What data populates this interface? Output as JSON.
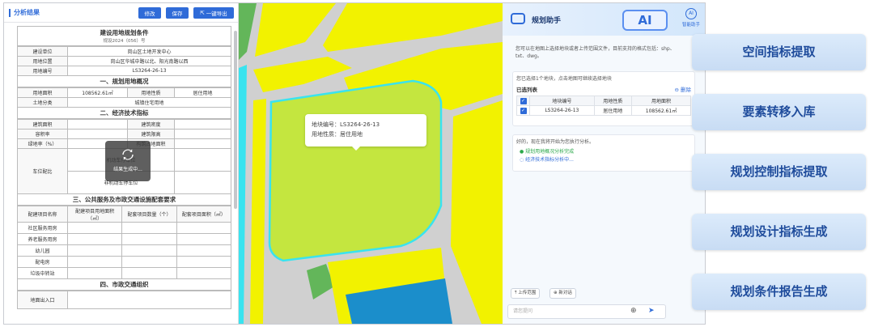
{
  "left_panel": {
    "title": "分析结果",
    "buttons": {
      "edit": "修改",
      "save": "保存",
      "export": "一键导出"
    },
    "doc": {
      "title": "建设用地规划条件",
      "subtitle": "规设2024（056）号",
      "rows": [
        {
          "label": "建设单位",
          "value": "岗山区土地开发中心"
        },
        {
          "label": "用地位置",
          "value": "岗山区华城中路以北、阳光南路以西"
        },
        {
          "label": "用地编号",
          "value": "LS3264-26-13"
        }
      ],
      "section1": "一、规划用地概况",
      "area_label": "用地面积",
      "area_value": "108562.61㎡",
      "nature_label": "用地性质",
      "nature_value": "居住用地",
      "land_class_label": "土地分类",
      "land_class_value": "城镇住宅用地",
      "section2": "二、经济技术指标",
      "econ_rows": [
        {
          "l1": "建筑面积",
          "l2": "建筑密度"
        },
        {
          "l1": "容积率",
          "l2": "建筑限高"
        },
        {
          "l1": "绿地率（%）",
          "l2": "构筑占地面积"
        }
      ],
      "parking_label": "车位配比",
      "parking_motor": "机动车停车位",
      "parking_nonmotor": "非机动车停车位",
      "section3": "三、公共服务及市政交通设施配套要求",
      "facility_headers": [
        "配建项目名称",
        "配建项目用地面积（㎡）",
        "配套项目数量（个）",
        "配套项目面积（㎡）"
      ],
      "facilities": [
        "社区服务用房",
        "养老服务用房",
        "幼儿园",
        "配电房",
        "垃圾中转站"
      ],
      "section4": "四、市政交通组织",
      "entrance_label": "地面出入口"
    },
    "loading_text": "结果生成中..."
  },
  "map": {
    "tooltip_line1": "地块编号：LS3264-26-13",
    "tooltip_line2": "用地性质：居住用地",
    "colors": {
      "yellow": "#f2f200",
      "lime": "#c4e63f",
      "green": "#63b65a",
      "blue": "#1b8ecb",
      "cyan": "#39e3ef",
      "road": "#d0d0d0"
    }
  },
  "assistant": {
    "title": "规划助手",
    "ai_badge": "AI",
    "assist_label": "智能助手",
    "intro": "您可以在地图上选择地块或者上传范围文件，目前支持的格式包括：shp、txt、dwg。",
    "selected_msg": "您已选择1个地块，点击地图可继续选择地块",
    "list_title": "已选列表",
    "delete_label": "删除",
    "table_headers": [
      "地块编号",
      "用地性质",
      "用地面积"
    ],
    "table_rows": [
      {
        "id": "LS3264-26-13",
        "nature": "居住用地",
        "area": "108562.61㎡"
      }
    ],
    "analysis_msg": "好的，现在我将开始为您执行分析。",
    "step1": "规划用地概况分析完成",
    "step2": "经济技术指标分析中...",
    "upload_chip": "上传范围",
    "new_chat_chip": "新对话",
    "input_placeholder": "请您提问"
  },
  "features": [
    "空间指标提取",
    "要素转移入库",
    "规划控制指标提取",
    "规划设计指标生成",
    "规划条件报告生成"
  ]
}
